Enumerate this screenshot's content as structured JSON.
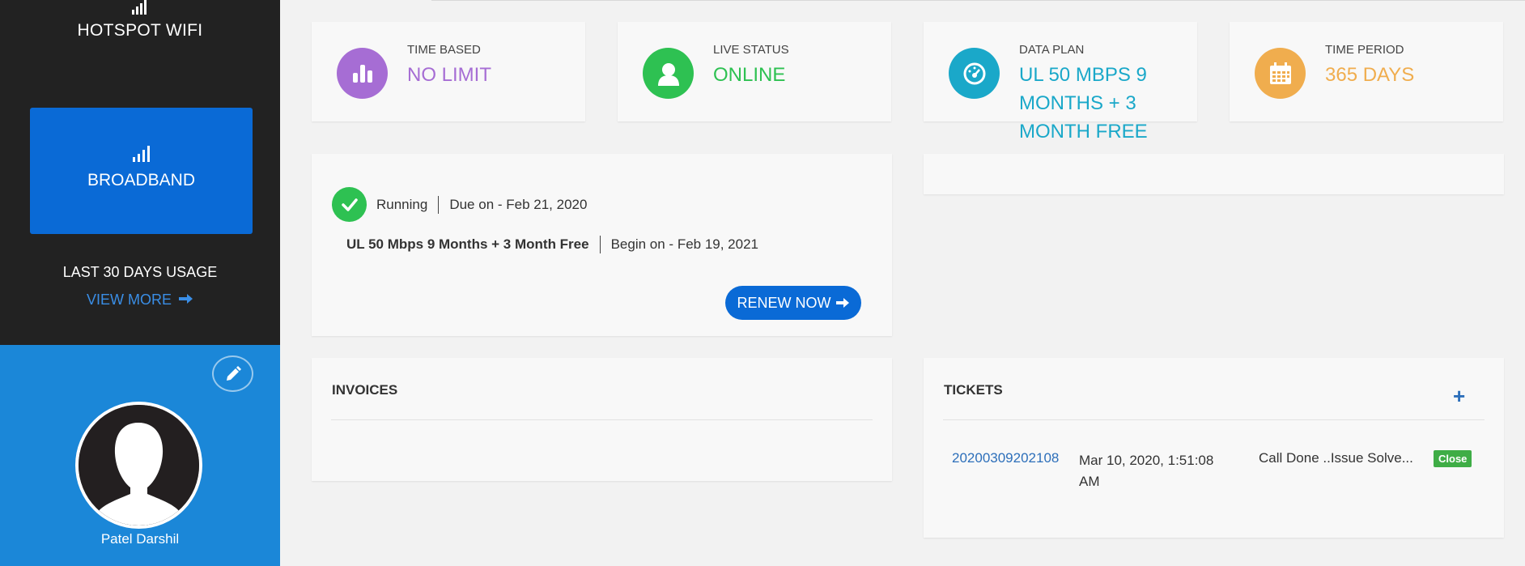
{
  "sidebar": {
    "hotspot_label": "HOTSPOT WIFI",
    "broadband_label": "BROADBAND",
    "usage_label": "LAST 30 DAYS USAGE",
    "view_more": "VIEW MORE",
    "profile_name": "Patel Darshil"
  },
  "stats": [
    {
      "label": "TIME BASED",
      "value": "NO LIMIT",
      "color": "#a66dd4",
      "icon": "bar-chart-icon"
    },
    {
      "label": "LIVE STATUS",
      "value": "ONLINE",
      "color": "#2ec152",
      "icon": "user-icon"
    },
    {
      "label": "DATA PLAN",
      "value": "UL 50 MBPS 9 MONTHS + 3 MONTH FREE",
      "color": "#1aa8c9",
      "icon": "speedometer-icon"
    },
    {
      "label": "TIME PERIOD",
      "value": "365 DAYS",
      "color": "#f0ad4e",
      "icon": "calendar-icon"
    }
  ],
  "plan": {
    "status": "Running",
    "due": "Due on - Feb 21, 2020",
    "name": "UL 50 Mbps 9 Months + 3 Month Free",
    "begin": "Begin on - Feb 19, 2021",
    "renew_label": "RENEW NOW"
  },
  "invoices": {
    "title": "INVOICES"
  },
  "tickets": {
    "title": "TICKETS",
    "add_label": "+",
    "rows": [
      {
        "id": "20200309202108",
        "date": "Mar 10, 2020, 1:51:08 AM",
        "description": "Call Done ..Issue Solve...",
        "status": "Close"
      }
    ]
  },
  "colors": {
    "sidebar_bg": "#222222",
    "broadband_bg": "#0a6ad6",
    "profile_bg": "#1b87d8",
    "accent_link": "#3a8ee6",
    "badge_close": "#3fad46"
  }
}
